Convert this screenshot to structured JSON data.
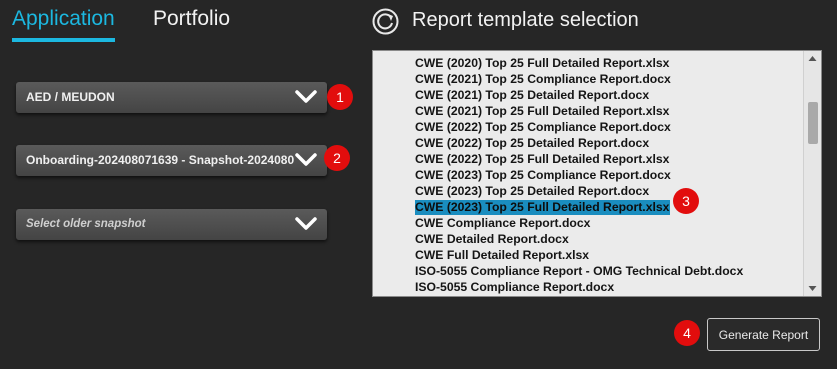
{
  "tabs": [
    {
      "label": "Application",
      "active": true
    },
    {
      "label": "Portfolio",
      "active": false
    }
  ],
  "dropdowns": {
    "application": "AED / MEUDON",
    "snapshot": "Onboarding-202408071639 - Snapshot-2024080",
    "older_snapshot_placeholder": "Select older snapshot"
  },
  "badges": [
    "1",
    "2",
    "3",
    "4"
  ],
  "panel": {
    "title": "Report template selection",
    "templates": [
      "CWE (2020) Top 25 Full Detailed Report.xlsx",
      "CWE (2021) Top 25 Compliance Report.docx",
      "CWE (2021) Top 25 Detailed Report.docx",
      "CWE (2021) Top 25 Full Detailed Report.xlsx",
      "CWE (2022) Top 25 Compliance Report.docx",
      "CWE (2022) Top 25 Detailed Report.docx",
      "CWE (2022) Top 25 Full Detailed Report.xlsx",
      "CWE (2023) Top 25 Compliance Report.docx",
      "CWE (2023) Top 25 Detailed Report.docx",
      "CWE (2023) Top 25 Full Detailed Report.xlsx",
      "CWE Compliance Report.docx",
      "CWE Detailed Report.docx",
      "CWE Full Detailed Report.xlsx",
      "ISO-5055 Compliance Report - OMG Technical Debt.docx",
      "ISO-5055 Compliance Report.docx"
    ],
    "selected_index": 9
  },
  "generate_button": "Generate Report",
  "colors": {
    "accent": "#1cb8e0",
    "selection": "#1a8dbf",
    "badge": "#e20d0d",
    "background": "#262626"
  }
}
